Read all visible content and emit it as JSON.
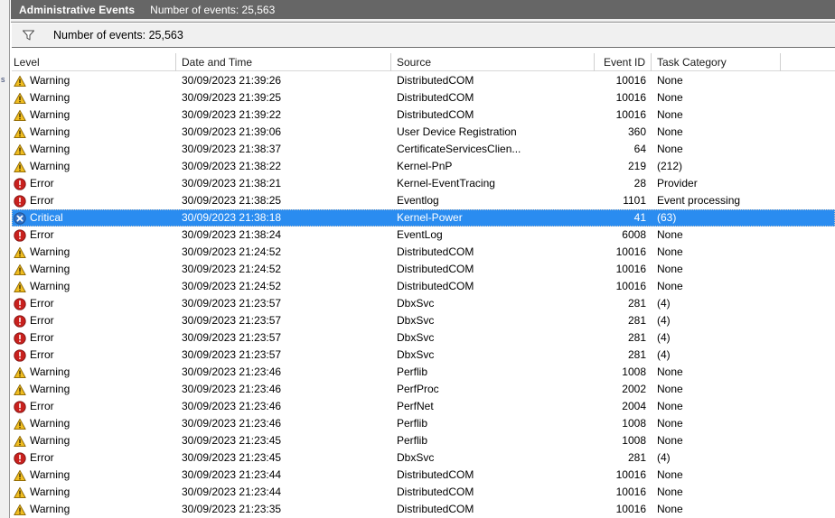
{
  "window": {
    "title": "Administrative Events",
    "subtitle": "Number of events: 25,563"
  },
  "filter_bar": {
    "icon": "filter-funnel-icon",
    "label": "Number of events: 25,563"
  },
  "columns": [
    {
      "key": "level",
      "label": "Level",
      "align": "left"
    },
    {
      "key": "date",
      "label": "Date and Time",
      "align": "left"
    },
    {
      "key": "source",
      "label": "Source",
      "align": "left"
    },
    {
      "key": "eventid",
      "label": "Event ID",
      "align": "right"
    },
    {
      "key": "task",
      "label": "Task Category",
      "align": "left"
    }
  ],
  "level_colors": {
    "Warning": "#f0bd20",
    "Error": "#c9211e",
    "Critical": "#2f6fc4",
    "selection": "#2a8cf0",
    "titlebar": "#666666"
  },
  "rows": [
    {
      "level": "Warning",
      "date": "30/09/2023 21:39:26",
      "source": "DistributedCOM",
      "eventid": "10016",
      "task": "None",
      "selected": false
    },
    {
      "level": "Warning",
      "date": "30/09/2023 21:39:25",
      "source": "DistributedCOM",
      "eventid": "10016",
      "task": "None",
      "selected": false
    },
    {
      "level": "Warning",
      "date": "30/09/2023 21:39:22",
      "source": "DistributedCOM",
      "eventid": "10016",
      "task": "None",
      "selected": false
    },
    {
      "level": "Warning",
      "date": "30/09/2023 21:39:06",
      "source": "User Device Registration",
      "eventid": "360",
      "task": "None",
      "selected": false
    },
    {
      "level": "Warning",
      "date": "30/09/2023 21:38:37",
      "source": "CertificateServicesClien...",
      "eventid": "64",
      "task": "None",
      "selected": false
    },
    {
      "level": "Warning",
      "date": "30/09/2023 21:38:22",
      "source": "Kernel-PnP",
      "eventid": "219",
      "task": "(212)",
      "selected": false
    },
    {
      "level": "Error",
      "date": "30/09/2023 21:38:21",
      "source": "Kernel-EventTracing",
      "eventid": "28",
      "task": "Provider",
      "selected": false
    },
    {
      "level": "Error",
      "date": "30/09/2023 21:38:25",
      "source": "Eventlog",
      "eventid": "1101",
      "task": "Event processing",
      "selected": false
    },
    {
      "level": "Critical",
      "date": "30/09/2023 21:38:18",
      "source": "Kernel-Power",
      "eventid": "41",
      "task": "(63)",
      "selected": true
    },
    {
      "level": "Error",
      "date": "30/09/2023 21:38:24",
      "source": "EventLog",
      "eventid": "6008",
      "task": "None",
      "selected": false
    },
    {
      "level": "Warning",
      "date": "30/09/2023 21:24:52",
      "source": "DistributedCOM",
      "eventid": "10016",
      "task": "None",
      "selected": false
    },
    {
      "level": "Warning",
      "date": "30/09/2023 21:24:52",
      "source": "DistributedCOM",
      "eventid": "10016",
      "task": "None",
      "selected": false
    },
    {
      "level": "Warning",
      "date": "30/09/2023 21:24:52",
      "source": "DistributedCOM",
      "eventid": "10016",
      "task": "None",
      "selected": false
    },
    {
      "level": "Error",
      "date": "30/09/2023 21:23:57",
      "source": "DbxSvc",
      "eventid": "281",
      "task": "(4)",
      "selected": false
    },
    {
      "level": "Error",
      "date": "30/09/2023 21:23:57",
      "source": "DbxSvc",
      "eventid": "281",
      "task": "(4)",
      "selected": false
    },
    {
      "level": "Error",
      "date": "30/09/2023 21:23:57",
      "source": "DbxSvc",
      "eventid": "281",
      "task": "(4)",
      "selected": false
    },
    {
      "level": "Error",
      "date": "30/09/2023 21:23:57",
      "source": "DbxSvc",
      "eventid": "281",
      "task": "(4)",
      "selected": false
    },
    {
      "level": "Warning",
      "date": "30/09/2023 21:23:46",
      "source": "Perflib",
      "eventid": "1008",
      "task": "None",
      "selected": false
    },
    {
      "level": "Warning",
      "date": "30/09/2023 21:23:46",
      "source": "PerfProc",
      "eventid": "2002",
      "task": "None",
      "selected": false
    },
    {
      "level": "Error",
      "date": "30/09/2023 21:23:46",
      "source": "PerfNet",
      "eventid": "2004",
      "task": "None",
      "selected": false
    },
    {
      "level": "Warning",
      "date": "30/09/2023 21:23:46",
      "source": "Perflib",
      "eventid": "1008",
      "task": "None",
      "selected": false
    },
    {
      "level": "Warning",
      "date": "30/09/2023 21:23:45",
      "source": "Perflib",
      "eventid": "1008",
      "task": "None",
      "selected": false
    },
    {
      "level": "Error",
      "date": "30/09/2023 21:23:45",
      "source": "DbxSvc",
      "eventid": "281",
      "task": "(4)",
      "selected": false
    },
    {
      "level": "Warning",
      "date": "30/09/2023 21:23:44",
      "source": "DistributedCOM",
      "eventid": "10016",
      "task": "None",
      "selected": false
    },
    {
      "level": "Warning",
      "date": "30/09/2023 21:23:44",
      "source": "DistributedCOM",
      "eventid": "10016",
      "task": "None",
      "selected": false
    },
    {
      "level": "Warning",
      "date": "30/09/2023 21:23:35",
      "source": "DistributedCOM",
      "eventid": "10016",
      "task": "None",
      "selected": false
    }
  ],
  "left_sliver": {
    "text": "s"
  }
}
